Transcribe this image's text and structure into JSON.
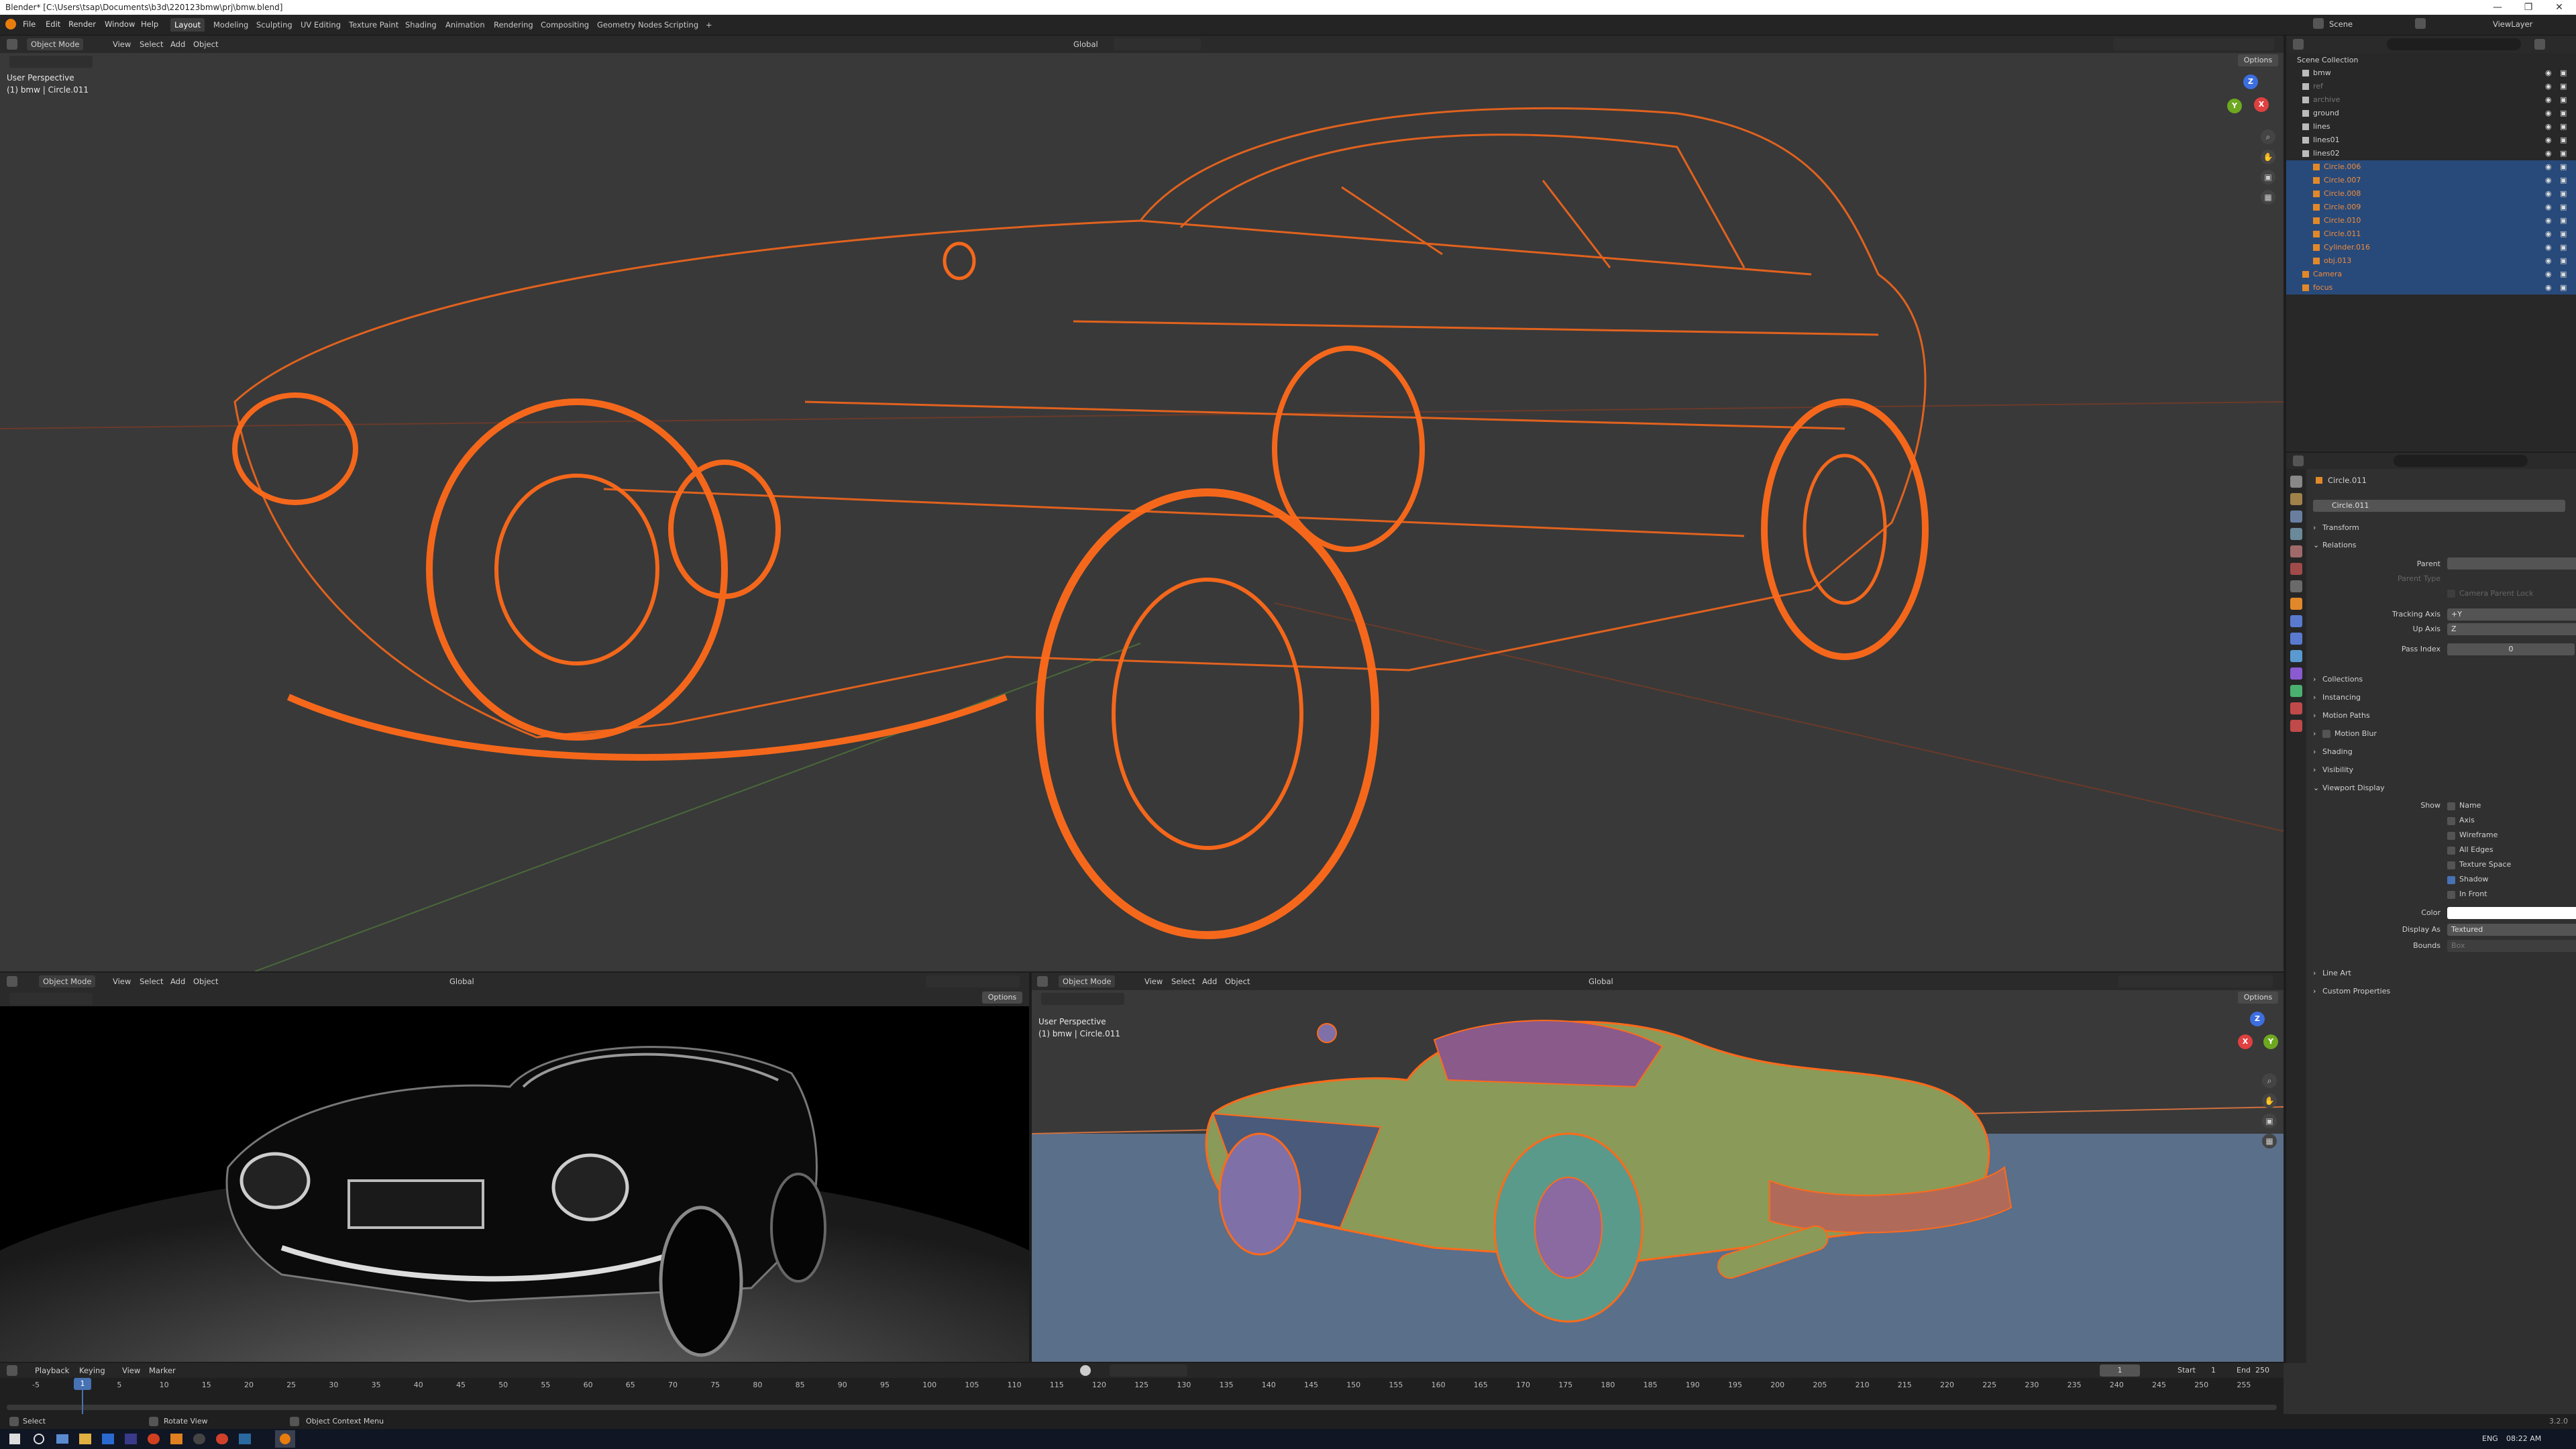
{
  "window": {
    "title": "Blender* [C:\\Users\\tsap\\Documents\\b3d\\220123bmw\\prj\\bmw.blend]",
    "min": "—",
    "max": "❐",
    "close": "✕"
  },
  "menu": {
    "items": [
      "File",
      "Edit",
      "Render",
      "Window",
      "Help"
    ]
  },
  "workspaces": {
    "tabs": [
      "Layout",
      "Modeling",
      "Sculpting",
      "UV Editing",
      "Texture Paint",
      "Shading",
      "Animation",
      "Rendering",
      "Compositing",
      "Geometry Nodes",
      "Scripting"
    ],
    "add": "+",
    "active": "Layout"
  },
  "top_right": {
    "scene": "Scene",
    "view_layer": "ViewLayer"
  },
  "viewport_main": {
    "mode": "Object Mode",
    "menus": [
      "View",
      "Select",
      "Add",
      "Object"
    ],
    "transform": "Global",
    "options": "Options",
    "overlay_title": "User Perspective",
    "overlay_sub": "(1) bmw | Circle.011",
    "gizmo": {
      "x": "X",
      "y": "Y",
      "z": "Z"
    },
    "accent": "#ff6a1a"
  },
  "viewport_render": {
    "mode": "Object Mode",
    "menus": [
      "View",
      "Select",
      "Add",
      "Object"
    ],
    "transform": "Global",
    "options": "Options"
  },
  "viewport_solid": {
    "mode": "Object Mode",
    "menus": [
      "View",
      "Select",
      "Add",
      "Object"
    ],
    "transform": "Global",
    "options": "Options",
    "overlay_title": "User Perspective",
    "overlay_sub": "(1) bmw | Circle.011"
  },
  "outliner": {
    "header": "Scene Collection",
    "rows": [
      {
        "name": "bmw",
        "indent": 1,
        "selected": false,
        "orange": false
      },
      {
        "name": "ref",
        "indent": 1,
        "selected": false,
        "orange": false,
        "dim": true
      },
      {
        "name": "archive",
        "indent": 1,
        "selected": false,
        "orange": false,
        "dim": true
      },
      {
        "name": "ground",
        "indent": 1,
        "selected": false,
        "orange": false
      },
      {
        "name": "lines",
        "indent": 1,
        "selected": false,
        "orange": false
      },
      {
        "name": "lines01",
        "indent": 1,
        "selected": false,
        "orange": false
      },
      {
        "name": "lines02",
        "indent": 1,
        "selected": false,
        "orange": false
      },
      {
        "name": "Circle.006",
        "indent": 2,
        "selected": true,
        "orange": true
      },
      {
        "name": "Circle.007",
        "indent": 2,
        "selected": true,
        "orange": true
      },
      {
        "name": "Circle.008",
        "indent": 2,
        "selected": true,
        "orange": true
      },
      {
        "name": "Circle.009",
        "indent": 2,
        "selected": true,
        "orange": true
      },
      {
        "name": "Circle.010",
        "indent": 2,
        "selected": true,
        "orange": true
      },
      {
        "name": "Circle.011",
        "indent": 2,
        "selected": true,
        "orange": true
      },
      {
        "name": "Cylinder.016",
        "indent": 2,
        "selected": true,
        "orange": true
      },
      {
        "name": "obj.013",
        "indent": 2,
        "selected": true,
        "orange": true
      },
      {
        "name": "Camera",
        "indent": 1,
        "selected": true,
        "orange": true
      },
      {
        "name": "focus",
        "indent": 1,
        "selected": true,
        "orange": true
      }
    ]
  },
  "properties": {
    "object_name": "Circle.011",
    "data_name": "Circle.011",
    "panels": {
      "transform": "Transform",
      "relations": "Relations",
      "collections": "Collections",
      "instancing": "Instancing",
      "motion_paths": "Motion Paths",
      "motion_blur": "Motion Blur",
      "shading": "Shading",
      "visibility": "Visibility",
      "viewport_display": "Viewport Display",
      "line_art": "Line Art",
      "custom_properties": "Custom Properties"
    },
    "relations": {
      "parent_label": "Parent",
      "parent_type_label": "Parent Type",
      "camera_parent_lock": "Camera Parent Lock",
      "tracking_axis_label": "Tracking Axis",
      "tracking_axis": "+Y",
      "up_axis_label": "Up Axis",
      "up_axis": "Z",
      "pass_index_label": "Pass Index",
      "pass_index": "0"
    },
    "viewport_display": {
      "show_label": "Show",
      "name": "Name",
      "axis": "Axis",
      "wireframe": "Wireframe",
      "all_edges": "All Edges",
      "texture_space": "Texture Space",
      "shadow": "Shadow",
      "in_front": "In Front",
      "color_label": "Color",
      "display_as_label": "Display As",
      "display_as": "Textured",
      "bounds_label": "Bounds",
      "bounds": "Box"
    }
  },
  "timeline": {
    "menus": [
      "Playback",
      "Keying",
      "View",
      "Marker"
    ],
    "current_frame": "1",
    "start_label": "Start",
    "start": "1",
    "end_label": "End",
    "end": "250",
    "ticks": [
      "-5",
      "0",
      "5",
      "10",
      "15",
      "20",
      "25",
      "30",
      "35",
      "40",
      "45",
      "50",
      "55",
      "60",
      "65",
      "70",
      "75",
      "80",
      "85",
      "90",
      "95",
      "100",
      "105",
      "110",
      "115",
      "120",
      "125",
      "130",
      "135",
      "140",
      "145",
      "150",
      "155",
      "160",
      "165",
      "170",
      "175",
      "180",
      "185",
      "190",
      "195",
      "200",
      "205",
      "210",
      "215",
      "220",
      "225",
      "230",
      "235",
      "240",
      "245",
      "250",
      "255"
    ],
    "playhead": "1"
  },
  "status": {
    "select": "Select",
    "rotate": "Rotate View",
    "context": "Object Context Menu",
    "version": "3.2.0"
  },
  "taskbar": {
    "lang": "ENG",
    "time": "08:22 AM"
  }
}
